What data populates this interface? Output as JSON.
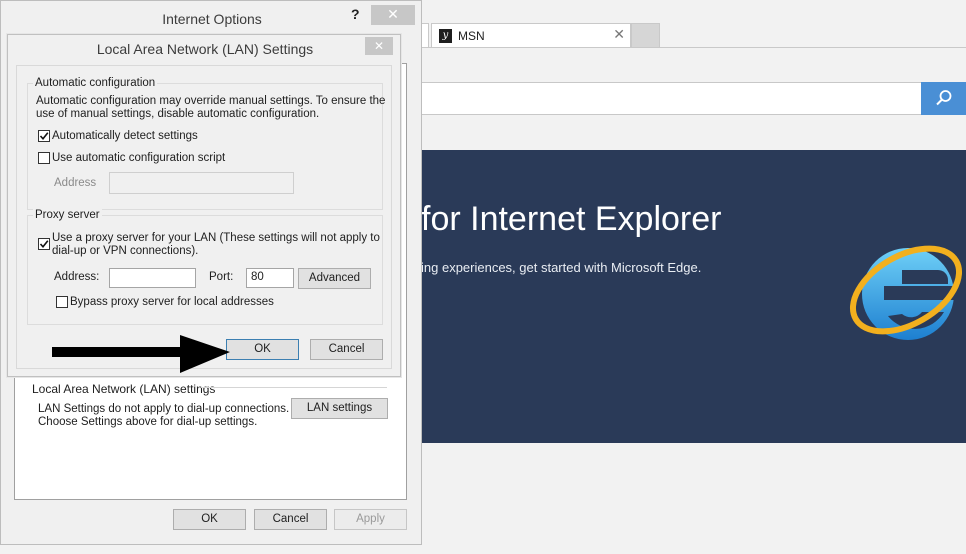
{
  "browser": {
    "tab": {
      "title": "MSN",
      "close_glyph": "✕",
      "logo_glyph": "y"
    },
    "search": {
      "value": "",
      "icon": "search-icon",
      "accent": "#4a8fd5"
    },
    "hero": {
      "title": "for Internet Explorer",
      "subtitle": "ing experiences, get started with Microsoft Edge.",
      "background": "#2a3a58",
      "logo": "internet-explorer-logo-icon"
    }
  },
  "internet_options": {
    "title": "Internet Options",
    "help_glyph": "?",
    "close_glyph": "✕",
    "lan_group": {
      "label": "Local Area Network (LAN) settings",
      "line1": "LAN Settings do not apply to dial-up connections.",
      "line2": "Choose Settings above for dial-up settings.",
      "button": "LAN settings"
    },
    "buttons": {
      "ok": "OK",
      "cancel": "Cancel",
      "apply": "Apply"
    }
  },
  "lan_dialog": {
    "title": "Local Area Network (LAN) Settings",
    "close_glyph": "✕",
    "auto_config": {
      "label": "Automatic configuration",
      "desc_line1": "Automatic configuration may override manual settings.  To ensure the",
      "desc_line2": "use of manual settings, disable automatic configuration.",
      "detect": {
        "label": "Automatically detect settings",
        "checked": true
      },
      "script": {
        "label": "Use automatic configuration script",
        "checked": false
      },
      "address_label": "Address",
      "address_value": ""
    },
    "proxy": {
      "label": "Proxy server",
      "use_proxy": {
        "label_line1": "Use a proxy server for your LAN (These settings will not apply to",
        "label_line2": "dial-up or VPN connections).",
        "checked": true
      },
      "address_label": "Address:",
      "address_value": "",
      "port_label": "Port:",
      "port_value": "80",
      "advanced": "Advanced",
      "bypass": {
        "label": "Bypass proxy server for local addresses",
        "checked": false
      }
    },
    "buttons": {
      "ok": "OK",
      "cancel": "Cancel"
    }
  },
  "annotation": {
    "arrow": "right-arrow-icon",
    "color": "#000000"
  }
}
